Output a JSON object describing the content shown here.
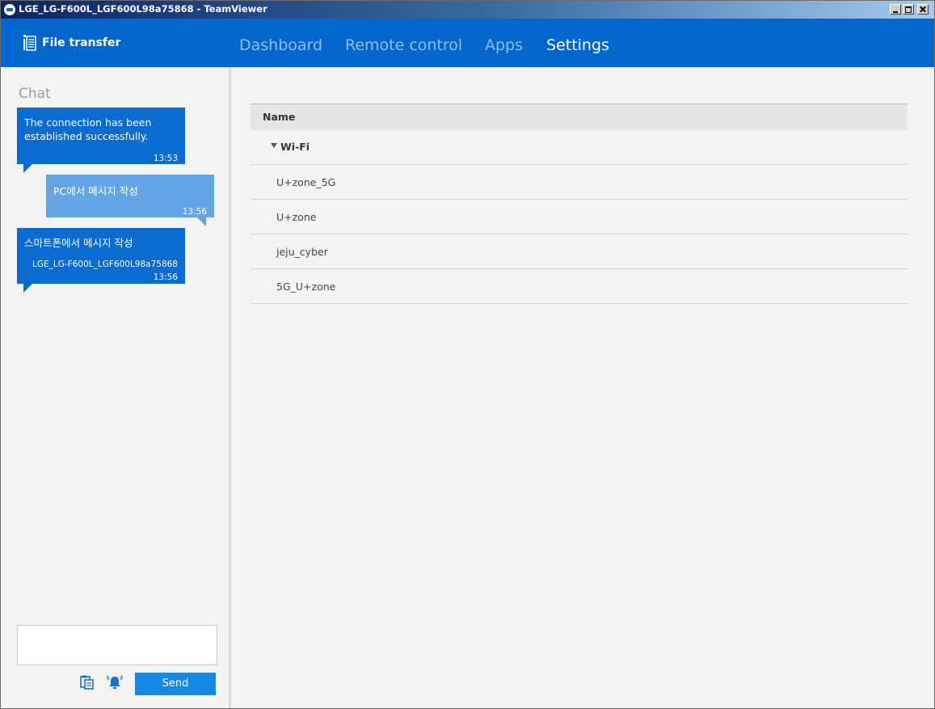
{
  "window": {
    "title": "LGE_LG-F600L_LGF600L98a75868 - TeamViewer",
    "logo_icon": "teamviewer-logo-icon",
    "controls": [
      "minimize-icon",
      "maximize-icon",
      "close-icon"
    ]
  },
  "header": {
    "file_transfer_label": "File transfer",
    "file_transfer_icon": "document-icon",
    "tabs": [
      {
        "label": "Dashboard",
        "active": false
      },
      {
        "label": "Remote control",
        "active": false
      },
      {
        "label": "Apps",
        "active": false
      },
      {
        "label": "Settings",
        "active": true
      }
    ],
    "accent_color": "#0266cc"
  },
  "chat": {
    "title": "Chat",
    "messages": [
      {
        "text": "The connection has been established successfully.",
        "line1": "The connection has been",
        "line2": "established successfully.",
        "time": "13:53",
        "direction": "incoming"
      },
      {
        "text": "PC에서 메시지 작성",
        "time": "13:56",
        "direction": "outgoing"
      },
      {
        "text": "스마트폰에서 메시지 작성",
        "sender": "LGE_LG-F600L_LGF600L98a75868",
        "time": "13:56",
        "direction": "incoming"
      }
    ],
    "input_value": "",
    "icons": [
      "file-clipboard-icon",
      "alarm-bell-icon"
    ],
    "send_label": "Send"
  },
  "settings_table": {
    "header": "Name",
    "group": {
      "label": "Wi-Fi",
      "expanded": true
    },
    "rows": [
      "U+zone_5G",
      "U+zone",
      "jeju_cyber",
      "5G_U+zone"
    ]
  }
}
